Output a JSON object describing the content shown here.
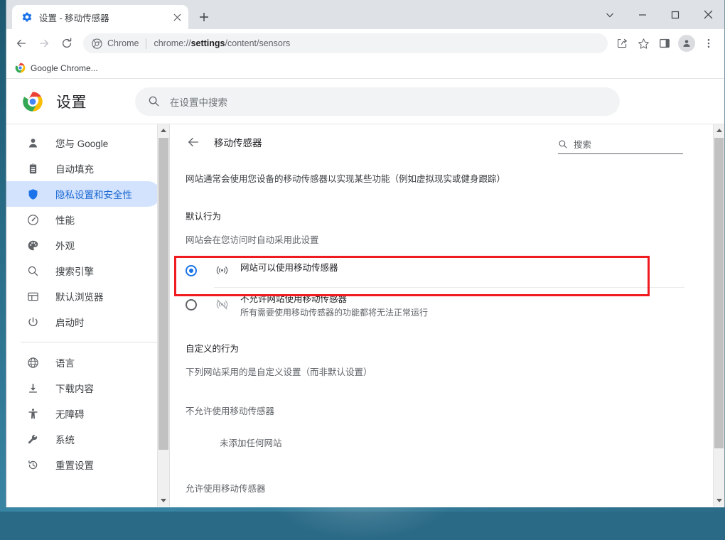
{
  "window": {
    "controls": [
      {
        "name": "tab-search",
        "glyph": "chevron-down"
      },
      {
        "name": "minimize",
        "glyph": "minimize"
      },
      {
        "name": "maximize",
        "glyph": "maximize"
      },
      {
        "name": "close",
        "glyph": "close"
      }
    ]
  },
  "tabs": [
    {
      "title": "设置 - 移动传感器",
      "favicon": "gear-icon",
      "active": true
    }
  ],
  "newtab": {
    "label": "+"
  },
  "toolbar": {
    "back": "←",
    "forward": "→",
    "reload": "⟳",
    "omnibox": {
      "chip_label": "Chrome",
      "url_prefix": "chrome://",
      "url_bold": "settings",
      "url_suffix": "/content/sensors",
      "full_url": "chrome://settings/content/sensors"
    },
    "share_icon": "share-icon",
    "bookmark_icon": "star-icon",
    "sidepanel_icon": "side-panel-icon",
    "profile_icon": "avatar-icon",
    "menu_icon": "three-dot-menu-icon"
  },
  "bookmarks_bar": {
    "items": [
      {
        "label": "Google Chrome...",
        "icon": "chrome-logo-icon"
      }
    ]
  },
  "settings_header": {
    "logo": "chrome-logo-icon",
    "title": "设置",
    "search_placeholder": "在设置中搜索",
    "search_value": "",
    "search_icon": "search-icon"
  },
  "sidebar": {
    "groups": [
      {
        "items": [
          {
            "label": "您与 Google",
            "icon": "person-icon",
            "active": false
          },
          {
            "label": "自动填充",
            "icon": "clipboard-icon",
            "active": false
          },
          {
            "label": "隐私设置和安全性",
            "icon": "shield-icon",
            "active": true
          },
          {
            "label": "性能",
            "icon": "speedometer-icon",
            "active": false
          },
          {
            "label": "外观",
            "icon": "palette-icon",
            "active": false
          },
          {
            "label": "搜索引擎",
            "icon": "search-icon",
            "active": false
          },
          {
            "label": "默认浏览器",
            "icon": "browser-window-icon",
            "active": false
          },
          {
            "label": "启动时",
            "icon": "power-icon",
            "active": false
          }
        ]
      },
      {
        "items": [
          {
            "label": "语言",
            "icon": "globe-icon",
            "active": false
          },
          {
            "label": "下载内容",
            "icon": "download-icon",
            "active": false
          },
          {
            "label": "无障碍",
            "icon": "accessibility-icon",
            "active": false
          },
          {
            "label": "系统",
            "icon": "wrench-icon",
            "active": false
          },
          {
            "label": "重置设置",
            "icon": "history-restore-icon",
            "active": false
          }
        ]
      }
    ]
  },
  "main": {
    "back_icon": "back-arrow-icon",
    "title": "移动传感器",
    "search": {
      "label": "搜索",
      "icon": "search-icon",
      "value": ""
    },
    "description": "网站通常会使用您设备的移动传感器以实现某些功能（例如虚拟现实或健身跟踪）",
    "default_behavior": {
      "heading": "默认行为",
      "sub": "网站会在您访问时自动采用此设置",
      "options": [
        {
          "label": "网站可以使用移动传感器",
          "sublabel": "",
          "icon": "sensor-on-icon",
          "selected": true,
          "highlighted": true
        },
        {
          "label": "不允许网站使用移动传感器",
          "sublabel": "所有需要使用移动传感器的功能都将无法正常运行",
          "icon": "sensor-off-icon",
          "selected": false,
          "highlighted": false
        }
      ]
    },
    "custom_behavior": {
      "heading": "自定义的行为",
      "sub": "下列网站采用的是自定义设置（而非默认设置）",
      "blocked_heading": "不允许使用移动传感器",
      "blocked_empty": "未添加任何网站",
      "allowed_heading": "允许使用移动传感器"
    }
  },
  "colors": {
    "accent": "#1a73e8",
    "active_bg": "#d3e3fd",
    "highlight_box": "#ef1b20",
    "tabstrip_bg": "#dee1e6",
    "omnibox_bg": "#f1f3f4"
  }
}
